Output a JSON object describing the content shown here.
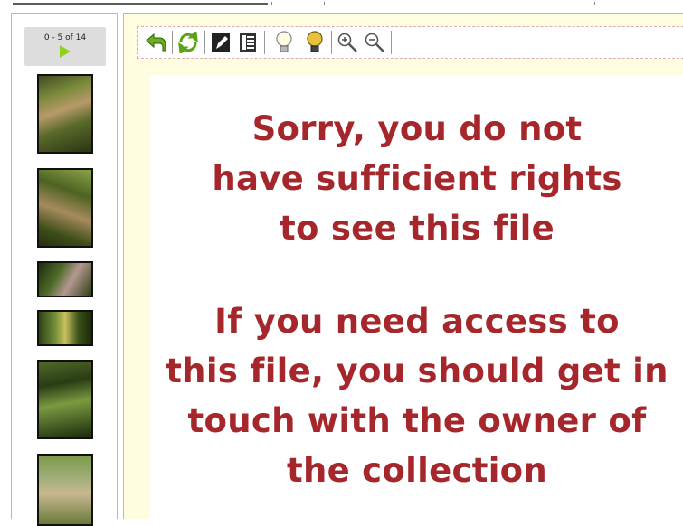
{
  "pager": {
    "label": "0 - 5 of 14",
    "next_icon": "play-next-icon"
  },
  "thumbnails": [
    {
      "name": "thumbnail-1"
    },
    {
      "name": "thumbnail-2"
    },
    {
      "name": "thumbnail-3"
    },
    {
      "name": "thumbnail-4"
    },
    {
      "name": "thumbnail-5"
    },
    {
      "name": "thumbnail-6"
    }
  ],
  "toolbar": {
    "buttons": [
      {
        "name": "back-icon"
      },
      {
        "name": "refresh-icon"
      },
      {
        "name": "edit-icon"
      },
      {
        "name": "details-icon"
      },
      {
        "name": "lightbulb-off-icon"
      },
      {
        "name": "lightbulb-on-icon"
      },
      {
        "name": "zoom-in-icon"
      },
      {
        "name": "zoom-out-icon"
      }
    ]
  },
  "message": {
    "line1": "Sorry, you do not\nhave sufficient rights\nto see this file",
    "line2": "If you need access to\nthis file, you should get in\ntouch with the owner of\nthe collection"
  },
  "colors": {
    "message_text": "#a6272b",
    "main_background": "#fffce0",
    "panel_border": "#e3a6a0",
    "accent_green": "#8ed11f"
  }
}
